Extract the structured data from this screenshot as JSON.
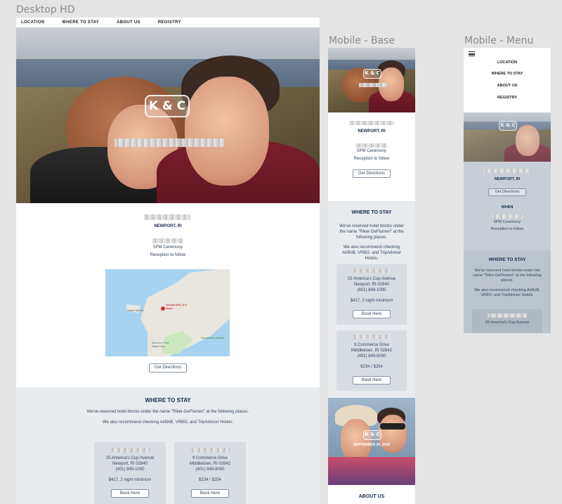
{
  "artboards": {
    "desktop": "Desktop HD",
    "mobile_base": "Mobile - Base",
    "mobile_menu": "Mobile - Menu"
  },
  "nav": {
    "location": "LOCATION",
    "where_to_stay": "WHERE TO STAY",
    "about_us": "ABOUT US",
    "registry": "REGISTRY"
  },
  "hero": {
    "monogram": "K & C"
  },
  "location": {
    "city": "NEWPORT, RI",
    "ceremony": "5PM Ceremony",
    "reception": "Reception to follow",
    "directions_label": "Get Directions",
    "when_heading": "WHEN",
    "map_labels": {
      "castle_hill": "Castle Hill Inn",
      "pin": "OceanCliff | & II Hotel",
      "park": "Brenton Point State Park",
      "cove": "Gooseberry Beach"
    }
  },
  "stay": {
    "heading": "WHERE TO STAY",
    "intro_desktop": "We've reserved hotel blocks under the name \"Riker-DeFlumeri\" at the following places.",
    "intro_mobile": "We've reserved hotel blocks under the name \"Riker-DeFlumeri\" at the following places.",
    "recommend_desktop": "We also recommend checking AirBnB, VRBO, and TripAdvisor Hotels.",
    "recommend_mobile": "We also recommend checking AirBnB, VRBO, and TripAdvisor Hotels.",
    "hotels": [
      {
        "street": "25 America's Cup Avenue",
        "city": "Newport, RI 02840",
        "phone": "(401) 849-1000",
        "price": "$417, 2 night minimum",
        "button": "Book Here"
      },
      {
        "street": "9 Commerce Drive",
        "city": "Middletown, RI 02842",
        "phone": "(401) 849-8000",
        "price": "$234 / $254",
        "button": "Book Here"
      }
    ]
  },
  "mobile2": {
    "date": "SEPTEMBER 29, 2018",
    "about_heading": "ABOUT US"
  },
  "menu_icon": "hamburger-icon"
}
